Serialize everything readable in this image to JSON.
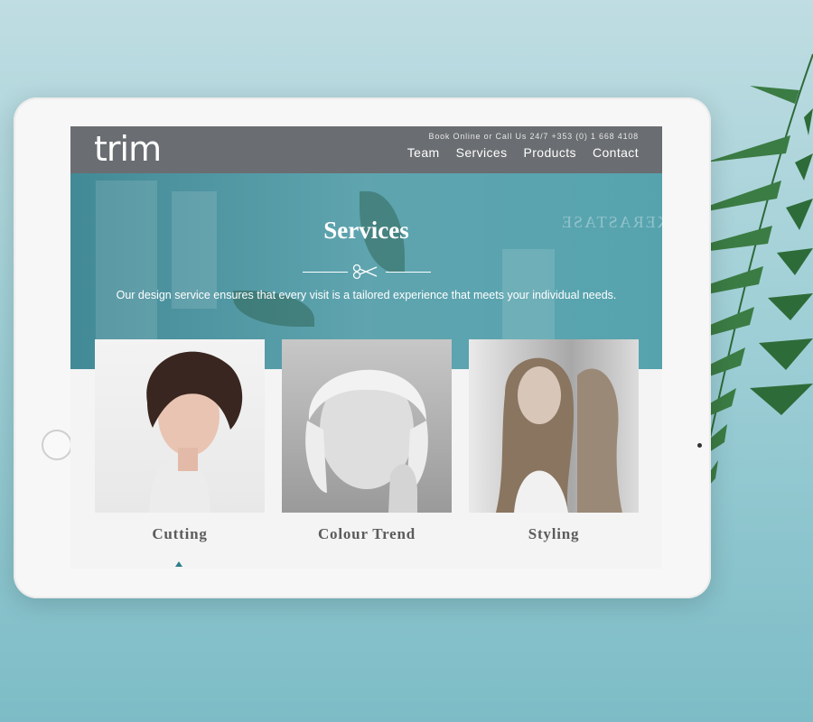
{
  "site": {
    "logo": "trim",
    "book_line": "Book Online or Call Us 24/7 +353 (0) 1 668 4108"
  },
  "nav": {
    "items": [
      "Team",
      "Services",
      "Products",
      "Contact"
    ]
  },
  "hero": {
    "title": "Services",
    "tagline": "Our design service ensures that every visit is a tailored experience that meets your individual needs.",
    "background_brand": "KERASTASE"
  },
  "cards": [
    {
      "label": "Cutting"
    },
    {
      "label": "Colour Trend"
    },
    {
      "label": "Styling"
    }
  ],
  "icons": {
    "divider": "scissors-icon"
  },
  "colors": {
    "header": "#6a6d71",
    "hero_overlay": "#3e93a0",
    "accent": "#2f7e8c",
    "label_text": "#5c5c5c"
  }
}
